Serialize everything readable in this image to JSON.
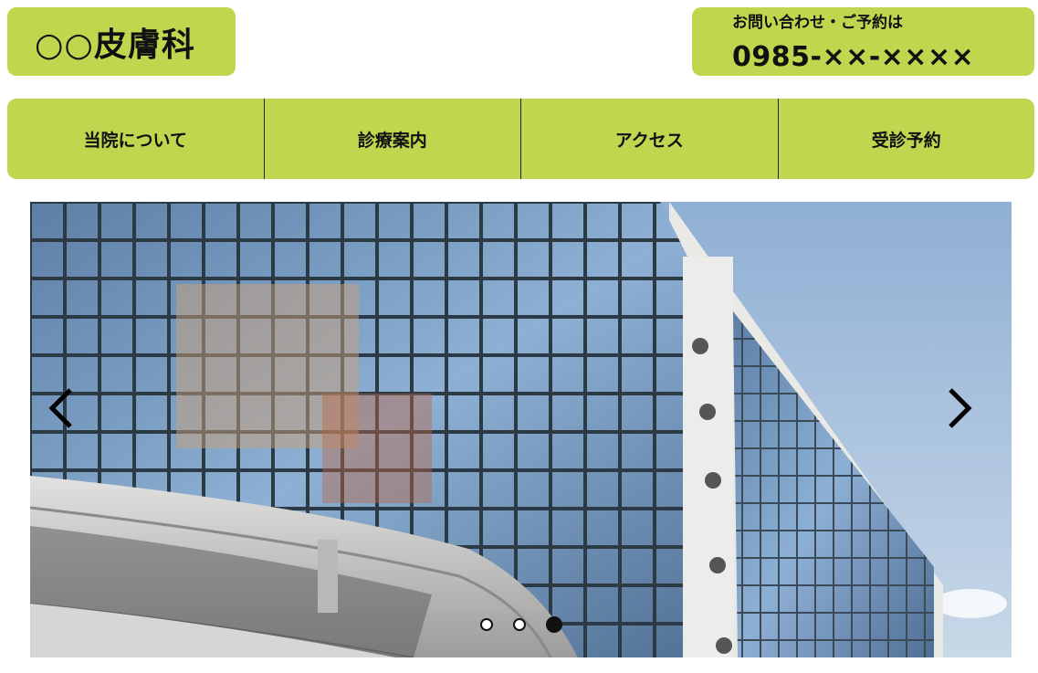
{
  "header": {
    "logo_text": "○○皮膚科",
    "contact_label": "お問い合わせ・ご予約は",
    "contact_phone": "0985-××-××××"
  },
  "nav": {
    "items": [
      {
        "label": "当院について"
      },
      {
        "label": "診療案内"
      },
      {
        "label": "アクセス"
      },
      {
        "label": "受診予約"
      }
    ]
  },
  "slider": {
    "image_description_icon": "building-photo",
    "prev_icon": "chevron-left-icon",
    "next_icon": "chevron-right-icon",
    "slide_count": 3,
    "active_index": 3
  },
  "colors": {
    "accent": "#bfd74f",
    "text": "#111111",
    "sky": "#a9c1dc"
  }
}
